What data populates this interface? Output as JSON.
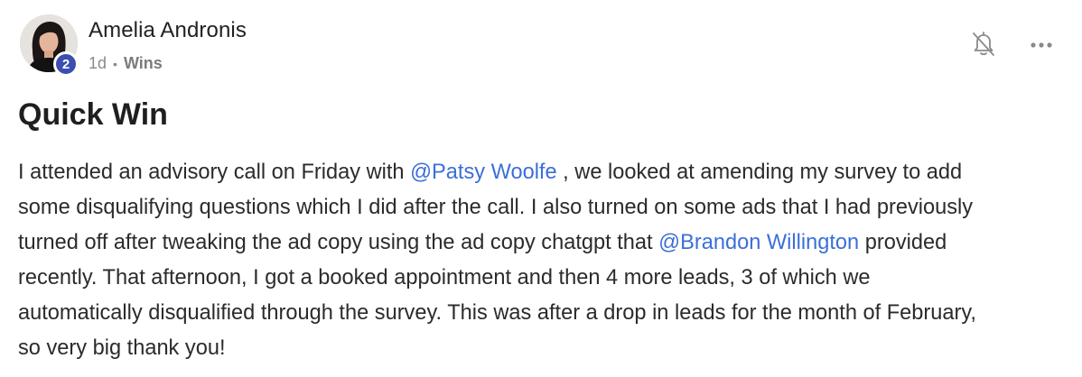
{
  "post": {
    "author": "Amelia Andronis",
    "level": "2",
    "time": "1d",
    "separator": "•",
    "category": "Wins",
    "title": "Quick Win",
    "lines": [
      {
        "a": "I attended an advisory call on Friday with ",
        "m": "@Patsy Woolfe",
        "b": " , we looked at amending my survey to add"
      },
      {
        "a": "some disqualifying questions which I did after the call. I also turned on some ads that I had previously"
      },
      {
        "a": "turned off after tweaking the ad copy using the ad copy chatgpt that ",
        "m": "@Brandon Willington",
        "b": " provided"
      },
      {
        "a": "recently. That afternoon, I got a booked appointment and then 4 more leads, 3 of which we"
      },
      {
        "a": "automatically disqualified through the survey. This was after a drop in leads for the month of February,"
      },
      {
        "a": "so very big thank you!"
      }
    ]
  },
  "icons": {
    "bell": "bell-off-icon",
    "more": "more-horizontal-icon"
  },
  "colors": {
    "mention": "#3b6fd8",
    "level_badge": "#3b4eb0",
    "meta_text": "#8a8a8a"
  }
}
